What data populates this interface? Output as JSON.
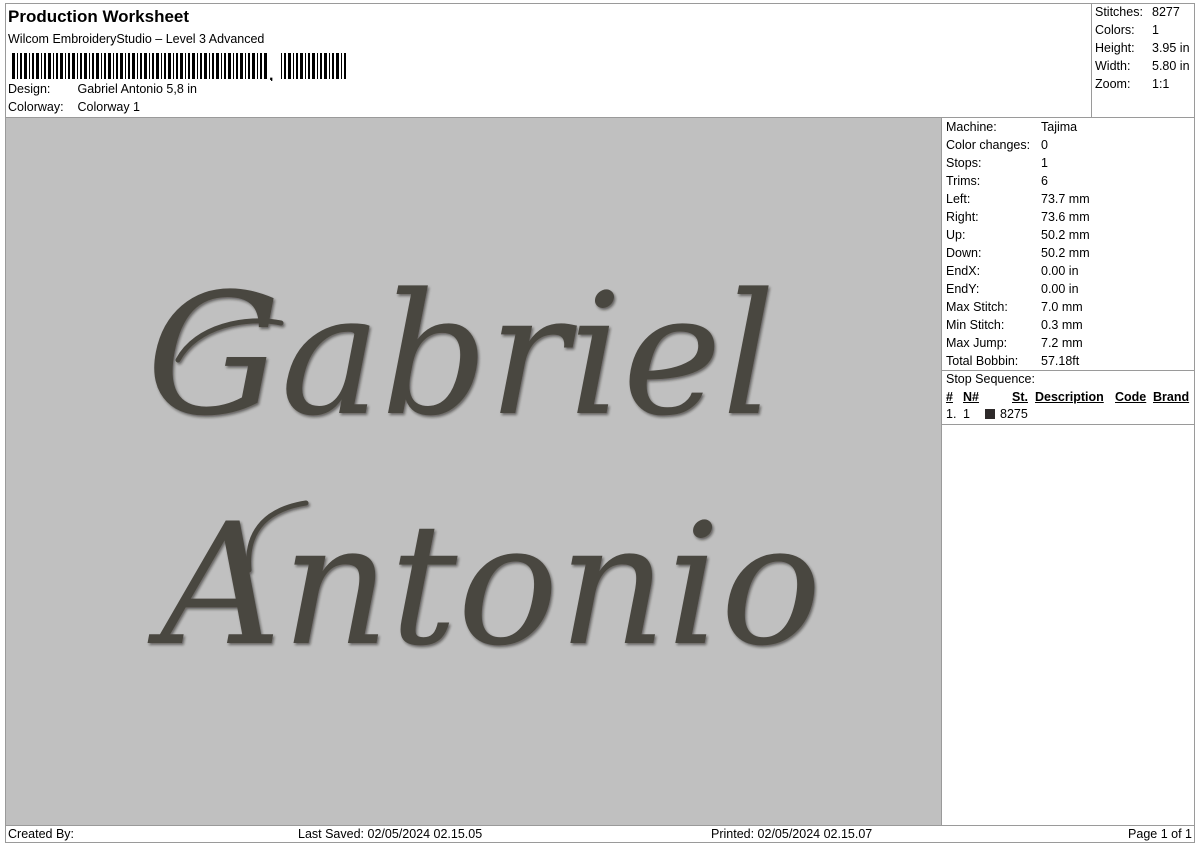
{
  "header": {
    "title": "Production Worksheet",
    "software": "Wilcom EmbroideryStudio – Level 3 Advanced",
    "design_label": "Design:",
    "design_value": "Gabriel Antonio 5,8 in",
    "colorway_label": "Colorway:",
    "colorway_value": "Colorway 1"
  },
  "summary": [
    {
      "label": "Stitches:",
      "value": "8277"
    },
    {
      "label": "Colors:",
      "value": "1"
    },
    {
      "label": "Height:",
      "value": "3.95 in"
    },
    {
      "label": "Width:",
      "value": "5.80 in"
    },
    {
      "label": "Zoom:",
      "value": "1:1"
    }
  ],
  "design_preview": {
    "line1": "Gabriel",
    "line2": "Antonio",
    "thread_color": "#4a4740",
    "background_color": "#c0c0c0"
  },
  "stats": [
    {
      "label": "Machine:",
      "value": "Tajima"
    },
    {
      "label": "Color changes:",
      "value": "0"
    },
    {
      "label": "Stops:",
      "value": "1"
    },
    {
      "label": "Trims:",
      "value": "6"
    },
    {
      "label": "Left:",
      "value": "73.7 mm"
    },
    {
      "label": "Right:",
      "value": "73.6 mm"
    },
    {
      "label": "Up:",
      "value": "50.2 mm"
    },
    {
      "label": "Down:",
      "value": "50.2 mm"
    },
    {
      "label": "EndX:",
      "value": "0.00 in"
    },
    {
      "label": "EndY:",
      "value": "0.00 in"
    },
    {
      "label": "Max Stitch:",
      "value": "7.0 mm"
    },
    {
      "label": "Min Stitch:",
      "value": "0.3 mm"
    },
    {
      "label": "Max Jump:",
      "value": "7.2 mm"
    },
    {
      "label": "Total Bobbin:",
      "value": "57.18ft"
    }
  ],
  "stop_sequence": {
    "title": "Stop Sequence:",
    "headers": [
      "#",
      "N#",
      "St.",
      "Description",
      "Code",
      "Brand"
    ],
    "rows": [
      {
        "index": "1.",
        "n": "1",
        "stitches": "8275",
        "color": "#2e2a2a"
      }
    ]
  },
  "footer": {
    "created_by": "Created By:",
    "last_saved": "Last Saved: 02/05/2024 02.15.05",
    "printed": "Printed: 02/05/2024 02.15.07",
    "page": "Page 1 of 1"
  }
}
